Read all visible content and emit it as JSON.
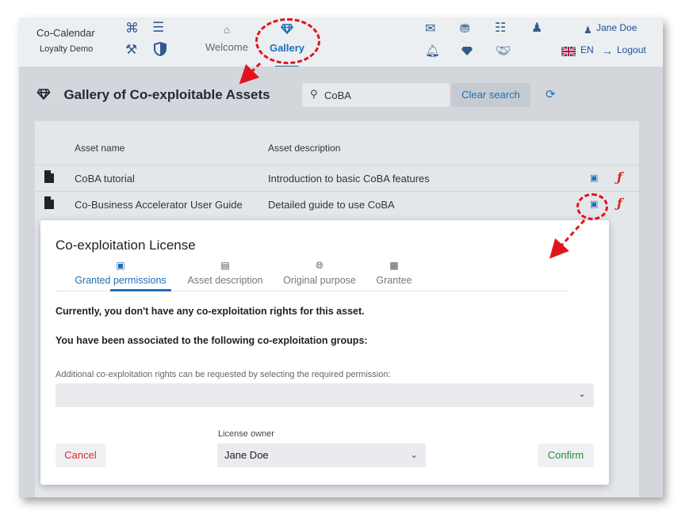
{
  "navbar": {
    "brand_name": "Co-Calendar",
    "brand_sub": "Loyalty Demo",
    "tabs": [
      {
        "label": "Welcome",
        "icon": "home-outline-icon"
      },
      {
        "label": "Gallery",
        "icon": "diamond-icon"
      }
    ],
    "user_name": "Jane Doe",
    "language": "EN",
    "logout_label": "Logout",
    "accent_color": "#1d6fb8"
  },
  "page": {
    "title": "Gallery of Co-exploitable Assets",
    "search_value": "CoBA",
    "clear_search_label": "Clear search"
  },
  "table": {
    "headers": [
      "Asset name",
      "Asset description"
    ],
    "rows": [
      {
        "name": "CoBA tutorial",
        "description": "Introduction to basic CoBA features"
      },
      {
        "name": "Co-Business Accelerator User Guide",
        "description": "Detailed guide to use CoBA"
      }
    ]
  },
  "modal": {
    "title": "Co-exploitation License",
    "tabs": [
      {
        "label": "Granted permissions",
        "icon": "license-icon"
      },
      {
        "label": "Asset description",
        "icon": "document-icon"
      },
      {
        "label": "Original purpose",
        "icon": "globe-icon"
      },
      {
        "label": "Grantee",
        "icon": "id-card-icon"
      }
    ],
    "no_rights_message": "Currently, you don't have any co-exploitation rights for this asset.",
    "groups_message": "You have been associated to the following co-exploitation groups:",
    "request_label": "Additional co-exploitation rights can be requested by selecting the required permission:",
    "owner_label": "License owner",
    "owner_value": "Jane Doe",
    "cancel_label": "Cancel",
    "confirm_label": "Confirm"
  },
  "annotation_color": "#e1141e"
}
